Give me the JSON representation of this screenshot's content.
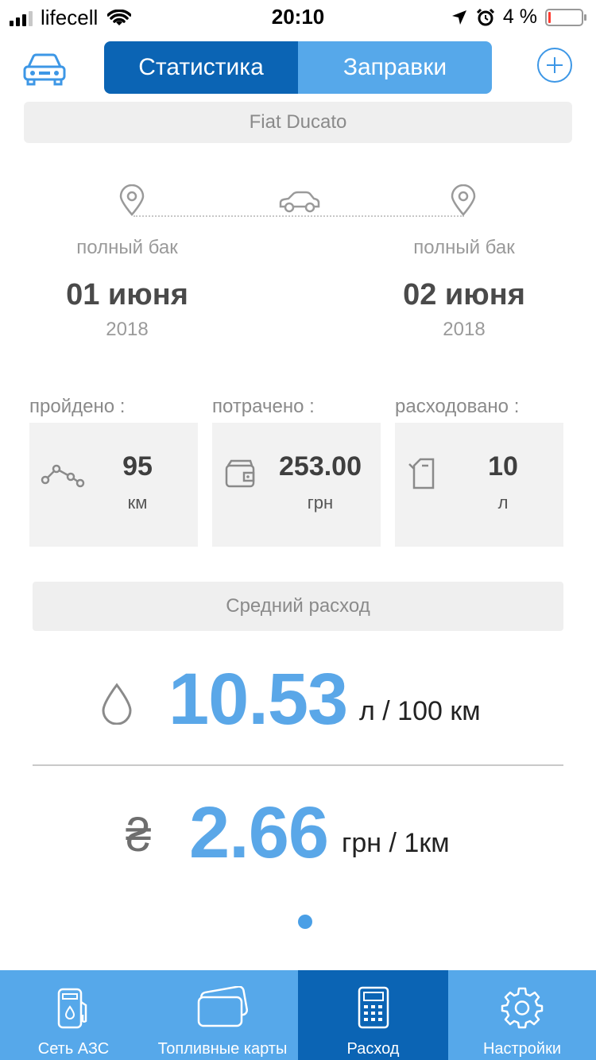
{
  "status_bar": {
    "carrier": "lifecell",
    "time": "20:10",
    "battery_percent": "4 %",
    "battery_level": 0.04,
    "battery_color": "#ff3b30"
  },
  "header": {
    "car_icon": "car-icon",
    "tabs": [
      {
        "label": "Статистика",
        "active": true
      },
      {
        "label": "Заправки",
        "active": false
      }
    ],
    "add_icon": "plus-circle-icon"
  },
  "vehicle": {
    "name": "Fiat Ducato"
  },
  "route": {
    "start": {
      "label": "полный бак",
      "date": "01 июня",
      "year": "2018"
    },
    "end": {
      "label": "полный бак",
      "date": "02 июня",
      "year": "2018"
    }
  },
  "stats": [
    {
      "label": "пройдено :",
      "value": "95",
      "unit": "км",
      "icon": "route-icon"
    },
    {
      "label": "потрачено :",
      "value": "253.00",
      "unit": "грн",
      "icon": "wallet-icon"
    },
    {
      "label": "расходовано :",
      "value": "10",
      "unit": "л",
      "icon": "fuel-can-icon"
    }
  ],
  "average": {
    "title": "Средний расход",
    "fuel_value": "10.53",
    "fuel_unit": "л / 100 км",
    "cost_symbol": "₴",
    "cost_value": "2.66",
    "cost_unit": "грн / 1км"
  },
  "tabbar": {
    "items": [
      {
        "label": "Сеть АЗС",
        "icon": "gas-station-icon",
        "active": false
      },
      {
        "label": "Топливные карты",
        "icon": "fuel-cards-icon",
        "active": false
      },
      {
        "label": "Расход",
        "icon": "calculator-icon",
        "active": true
      },
      {
        "label": "Настройки",
        "icon": "gear-icon",
        "active": false
      }
    ]
  },
  "colors": {
    "primary_dark": "#0b64b4",
    "primary_light": "#56a8ea",
    "accent_value": "#5aa7e8"
  }
}
